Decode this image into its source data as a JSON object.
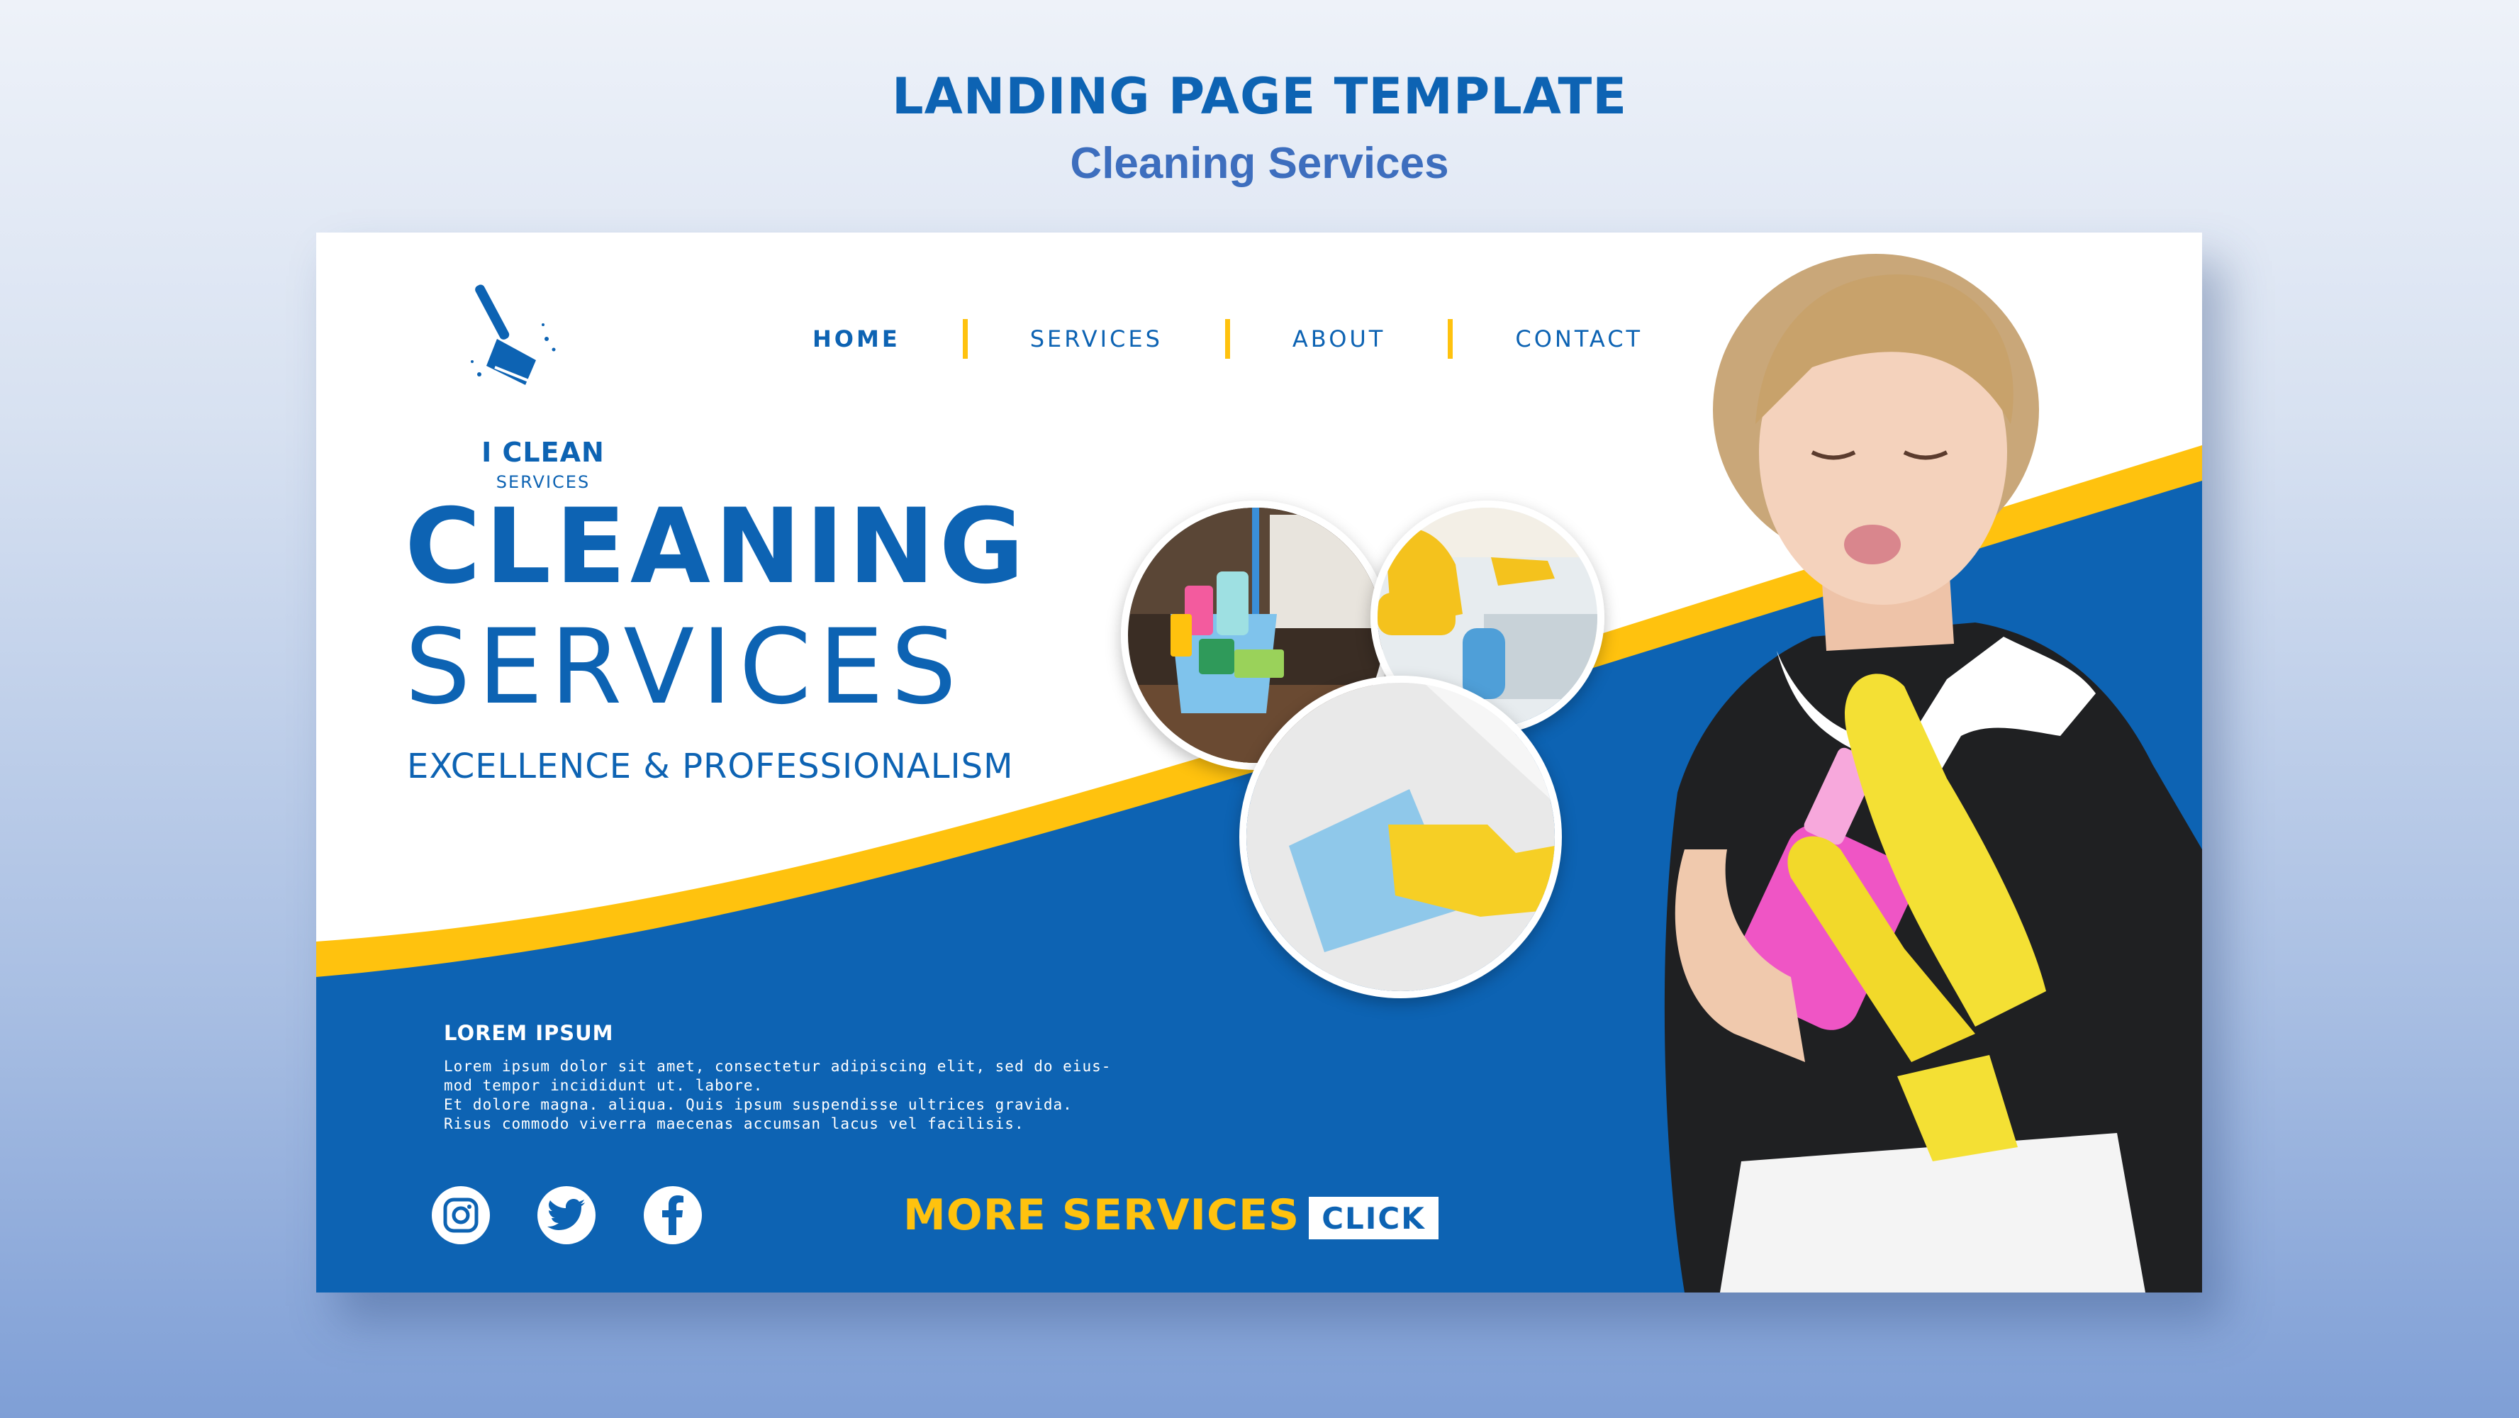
{
  "page": {
    "heading": "LANDING PAGE TEMPLATE",
    "subheading": "Cleaning Services"
  },
  "logo": {
    "title": "I CLEAN",
    "subtitle": "SERVICES",
    "icon": "broom-icon"
  },
  "nav": {
    "items": [
      {
        "label": "HOME",
        "active": true
      },
      {
        "label": "SERVICES",
        "active": false
      },
      {
        "label": "ABOUT",
        "active": false
      },
      {
        "label": "CONTACT",
        "active": false
      }
    ]
  },
  "hero": {
    "line1": "CLEANING",
    "line2": "SERVICES",
    "tagline": "EXCELLENCE & PROFESSIONALISM"
  },
  "info": {
    "title": "LOREM IPSUM",
    "lines": [
      "Lorem ipsum dolor sit amet, consectetur adipiscing elit, sed do eius-",
      "mod tempor incididunt ut. labore.",
      "Et dolore magna. aliqua. Quis ipsum suspendisse ultrices gravida.",
      "Risus commodo viverra maecenas accumsan lacus vel facilisis."
    ]
  },
  "social": [
    "instagram-icon",
    "twitter-icon",
    "facebook-icon"
  ],
  "cta": {
    "text": "MORE SERVICES",
    "button": "CLICK"
  },
  "colors": {
    "primary_blue": "#0d63b3",
    "accent_yellow": "#ffc20e",
    "background": "#ffffff"
  }
}
